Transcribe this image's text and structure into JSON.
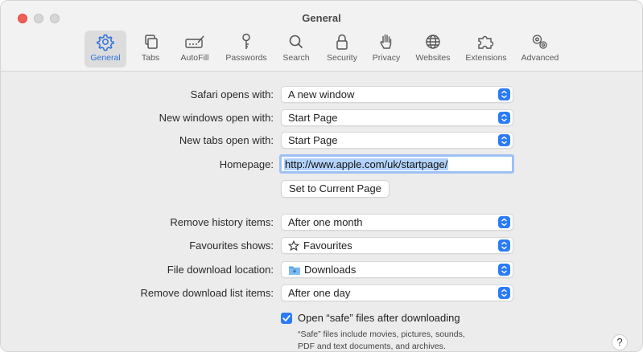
{
  "window": {
    "title": "General"
  },
  "toolbar": {
    "tabs": [
      {
        "label": "General",
        "icon": "gear-icon",
        "active": true
      },
      {
        "label": "Tabs",
        "icon": "tabs-icon",
        "active": false
      },
      {
        "label": "AutoFill",
        "icon": "autofill-icon",
        "active": false
      },
      {
        "label": "Passwords",
        "icon": "key-icon",
        "active": false
      },
      {
        "label": "Search",
        "icon": "search-icon",
        "active": false
      },
      {
        "label": "Security",
        "icon": "lock-icon",
        "active": false
      },
      {
        "label": "Privacy",
        "icon": "hand-icon",
        "active": false
      },
      {
        "label": "Websites",
        "icon": "globe-icon",
        "active": false
      },
      {
        "label": "Extensions",
        "icon": "puzzle-icon",
        "active": false
      },
      {
        "label": "Advanced",
        "icon": "gears-icon",
        "active": false
      }
    ]
  },
  "settings": {
    "safari_opens_with": {
      "label": "Safari opens with:",
      "value": "A new window"
    },
    "new_windows_open_with": {
      "label": "New windows open with:",
      "value": "Start Page"
    },
    "new_tabs_open_with": {
      "label": "New tabs open with:",
      "value": "Start Page"
    },
    "homepage": {
      "label": "Homepage:",
      "value": "http://www.apple.com/uk/startpage/"
    },
    "set_current_page_button": "Set to Current Page",
    "remove_history_items": {
      "label": "Remove history items:",
      "value": "After one month"
    },
    "favourites_shows": {
      "label": "Favourites shows:",
      "value": "Favourites",
      "icon": "star-icon"
    },
    "file_download_location": {
      "label": "File download location:",
      "value": "Downloads",
      "icon": "folder-icon"
    },
    "remove_download_list_items": {
      "label": "Remove download list items:",
      "value": "After one day"
    },
    "open_safe_files": {
      "label": "Open “safe” files after downloading",
      "checked": true,
      "note_line1": "“Safe” files include movies, pictures, sounds,",
      "note_line2": "PDF and text documents, and archives."
    }
  },
  "help_button": "?",
  "colors": {
    "accent": "#2c7bf6",
    "close": "#ee5e56",
    "selection": "#b3d3fb"
  }
}
